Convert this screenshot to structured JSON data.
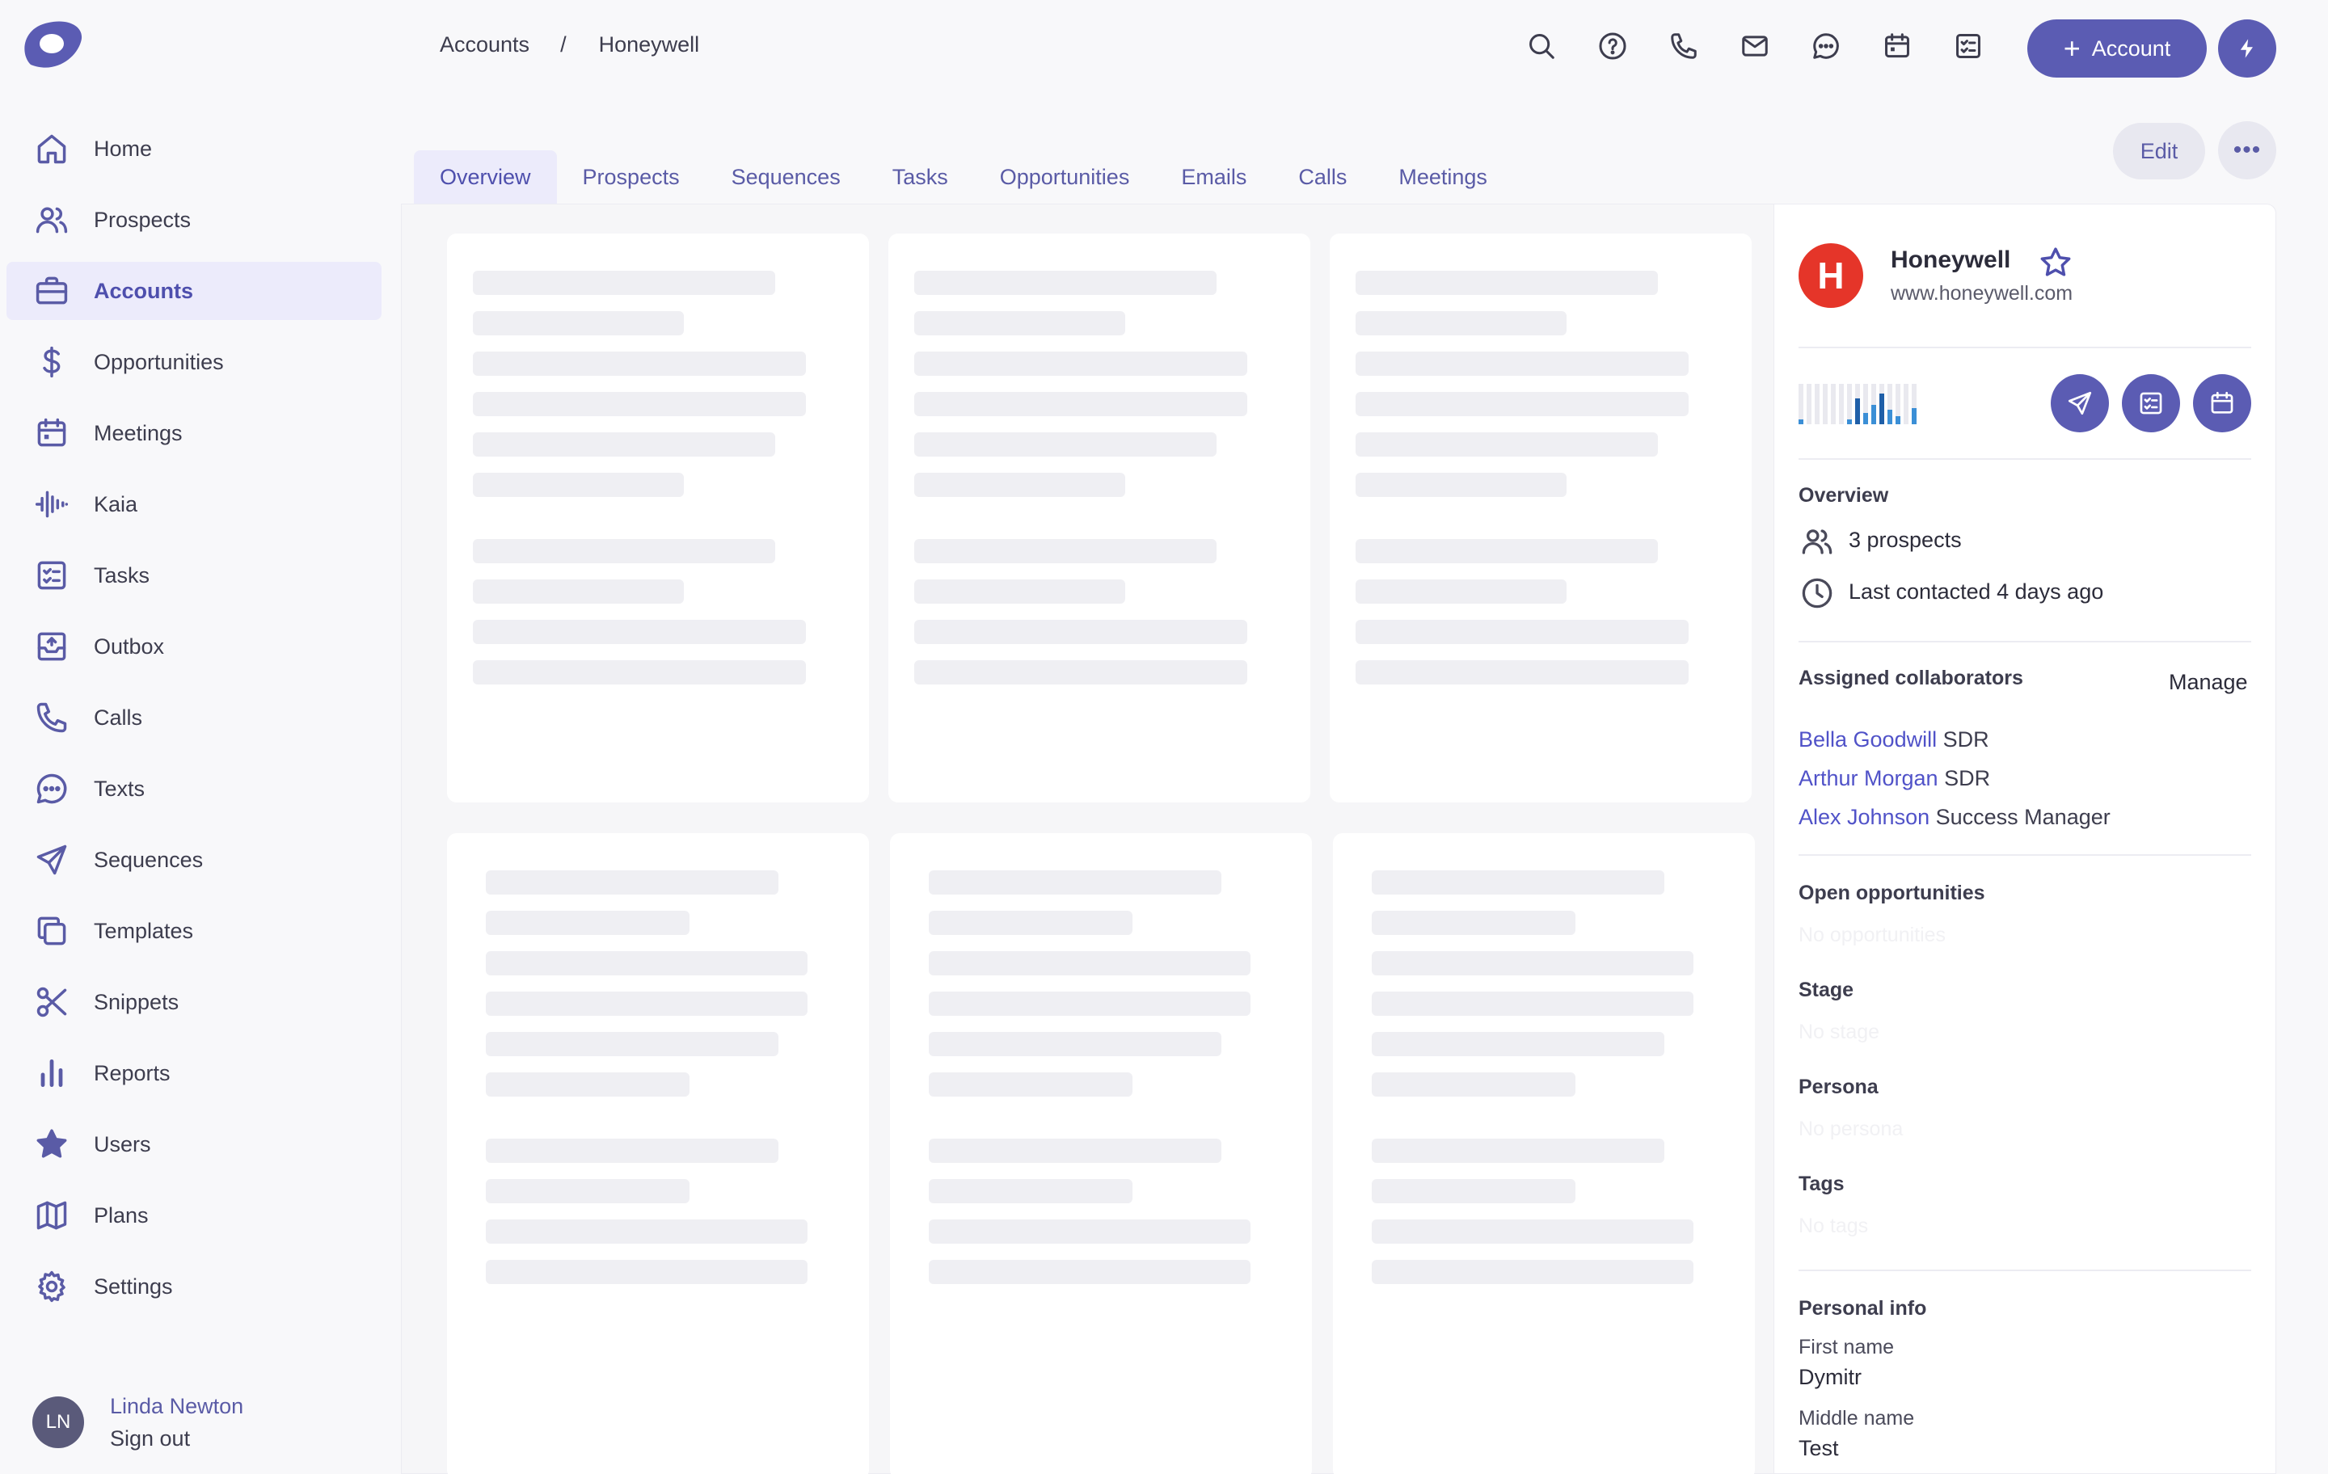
{
  "sidebar": {
    "items": [
      {
        "label": "Home",
        "icon": "home-icon",
        "active": false
      },
      {
        "label": "Prospects",
        "icon": "people-icon",
        "active": false
      },
      {
        "label": "Accounts",
        "icon": "briefcase-icon",
        "active": true
      },
      {
        "label": "Opportunities",
        "icon": "dollar-icon",
        "active": false
      },
      {
        "label": "Meetings",
        "icon": "calendar-icon",
        "active": false
      },
      {
        "label": "Kaia",
        "icon": "waveform-icon",
        "active": false
      },
      {
        "label": "Tasks",
        "icon": "task-list-icon",
        "active": false
      },
      {
        "label": "Outbox",
        "icon": "outbox-icon",
        "active": false
      },
      {
        "label": "Calls",
        "icon": "phone-icon",
        "active": false
      },
      {
        "label": "Texts",
        "icon": "chat-icon",
        "active": false
      },
      {
        "label": "Sequences",
        "icon": "send-icon",
        "active": false
      },
      {
        "label": "Templates",
        "icon": "copy-icon",
        "active": false
      },
      {
        "label": "Snippets",
        "icon": "scissors-icon",
        "active": false
      },
      {
        "label": "Reports",
        "icon": "bar-chart-icon",
        "active": false
      },
      {
        "label": "Users",
        "icon": "star-filled-icon",
        "active": false
      },
      {
        "label": "Plans",
        "icon": "map-icon",
        "active": false
      },
      {
        "label": "Settings",
        "icon": "gear-icon",
        "active": false
      }
    ],
    "user": {
      "initials": "LN",
      "name": "Linda Newton",
      "signout": "Sign out"
    }
  },
  "header": {
    "breadcrumb": {
      "parent": "Accounts",
      "separator": "/",
      "current": "Honeywell"
    },
    "icons": [
      "search-icon",
      "help-icon",
      "phone-icon",
      "mail-icon",
      "chat-icon",
      "calendar-icon",
      "task-icon"
    ],
    "add_button": "Account",
    "quick_action_icon": "bolt-icon"
  },
  "tabs": [
    "Overview",
    "Prospects",
    "Sequences",
    "Tasks",
    "Opportunities",
    "Emails",
    "Calls",
    "Meetings"
  ],
  "active_tab": "Overview",
  "actions": {
    "edit": "Edit",
    "more": "•••"
  },
  "account": {
    "logo_letter": "H",
    "name": "Honeywell",
    "website": "www.honeywell.com",
    "overview_title": "Overview",
    "prospects_link": "3 prospects",
    "last_contacted": "Last contacted 4 days ago",
    "collaborators_title": "Assigned collaborators",
    "manage": "Manage",
    "collaborators": [
      {
        "name": "Bella Goodwill",
        "role": "SDR"
      },
      {
        "name": "Arthur Morgan",
        "role": "SDR"
      },
      {
        "name": "Alex Johnson",
        "role": "Success Manager"
      }
    ],
    "open_opps_title": "Open opportunities",
    "open_opps_value": "No opportunities",
    "stage_title": "Stage",
    "stage_value": "No stage",
    "persona_title": "Persona",
    "persona_value": "No persona",
    "tags_title": "Tags",
    "tags_value": "No tags",
    "personal_title": "Personal info",
    "first_name_label": "First name",
    "first_name": "Dymitr",
    "middle_name_label": "Middle name",
    "middle_name": "Test"
  },
  "colors": {
    "accent": "#5b5cb3",
    "logo_red": "#e53529",
    "link": "#5052c8"
  }
}
